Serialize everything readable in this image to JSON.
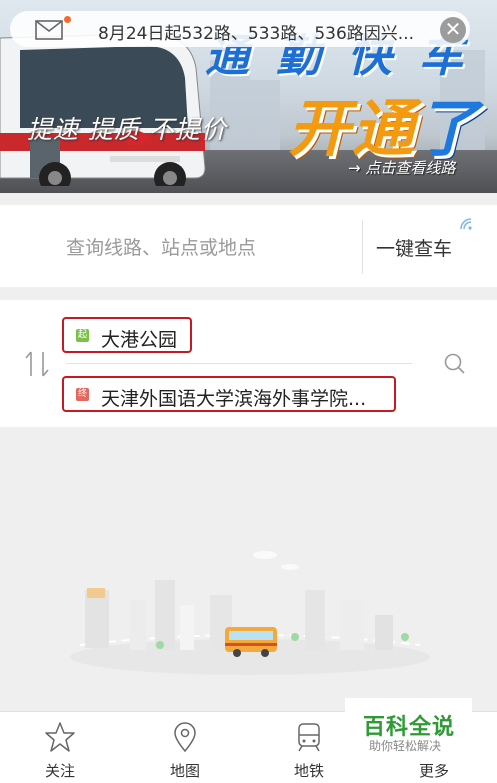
{
  "banner": {
    "headline": "通 勤 快 车",
    "kaitong_main": "开通",
    "kaitong_le": "了",
    "slogan": "提速 提质 不提价",
    "link": "→ 点击查看线路"
  },
  "notice": {
    "text": "8月24日起532路、533路、536路因兴...",
    "close": "✕"
  },
  "search": {
    "placeholder": "查询线路、站点或地点",
    "button": "一键查车"
  },
  "route": {
    "start_tag": "起",
    "start_name": "大港公园",
    "end_tag": "终",
    "end_name": "天津外国语大学滨海外事学院..."
  },
  "tabs": [
    {
      "label": "关注",
      "icon": "star-icon"
    },
    {
      "label": "地图",
      "icon": "map-pin-icon"
    },
    {
      "label": "地铁",
      "icon": "metro-icon"
    },
    {
      "label": "更多",
      "icon": "more-icon"
    }
  ],
  "watermark": {
    "big": "百科全说",
    "small": "助你轻松解决"
  },
  "colors": {
    "accent_green": "#46c35b",
    "start_tag": "#7cc04a",
    "end_tag": "#e5675e",
    "highlight_border": "#c41a20"
  }
}
